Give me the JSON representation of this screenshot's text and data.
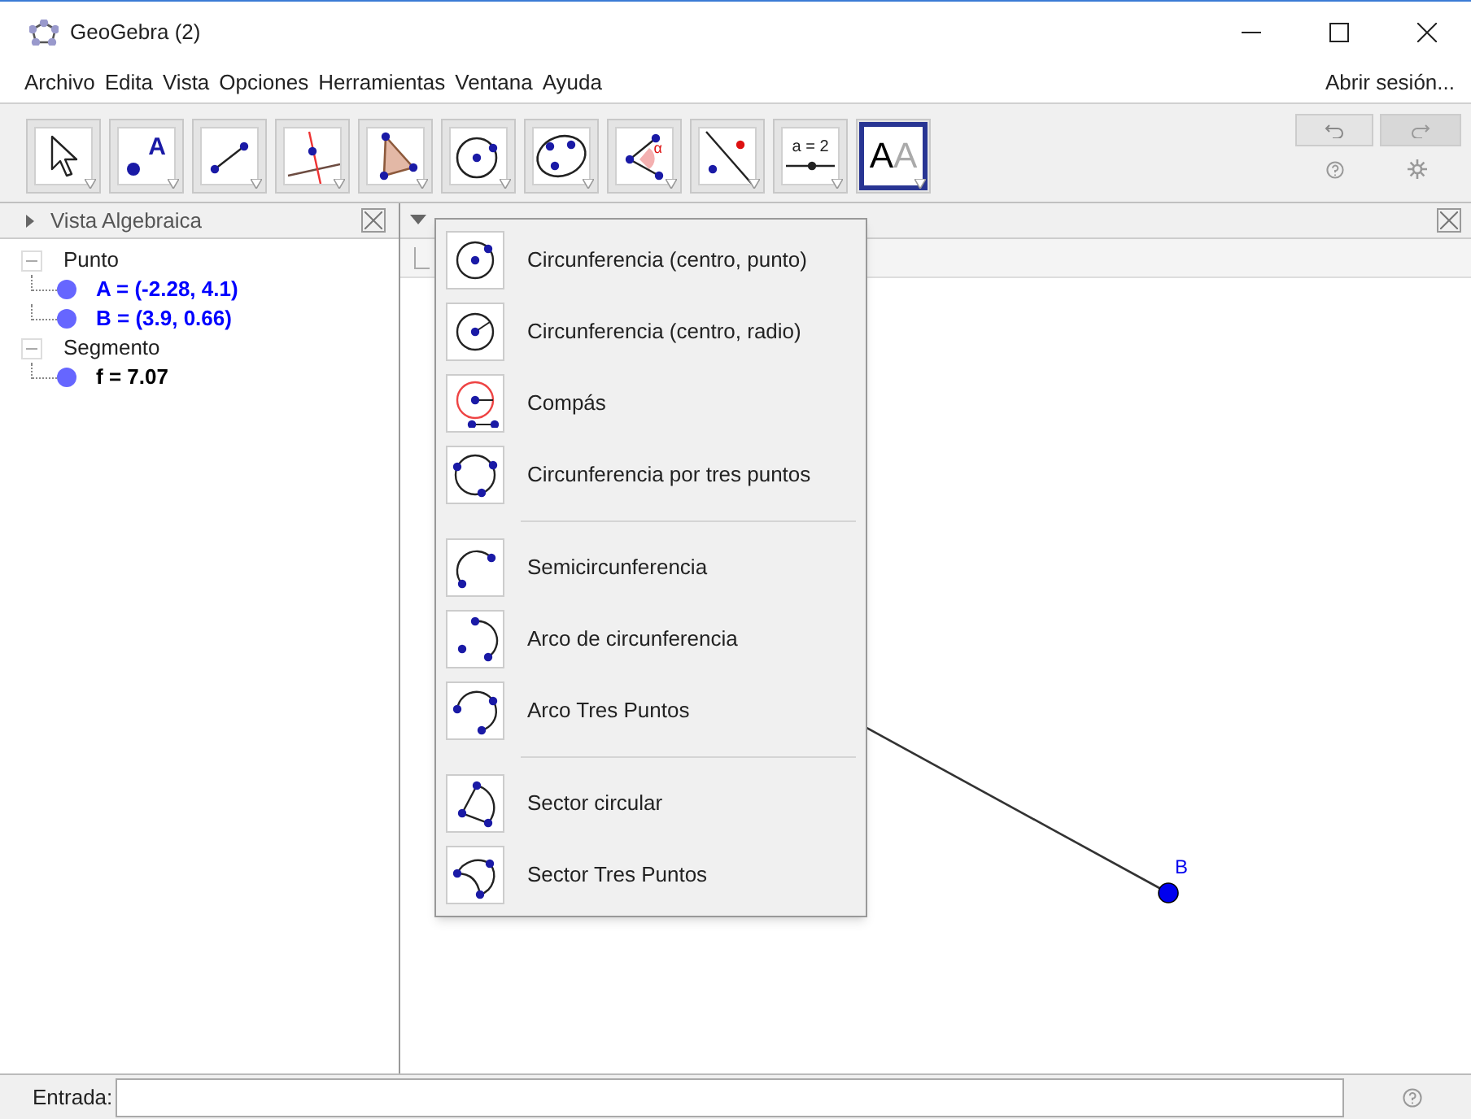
{
  "window": {
    "title": "GeoGebra (2)"
  },
  "menu_bar": {
    "items": [
      "Archivo",
      "Edita",
      "Vista",
      "Opciones",
      "Herramientas",
      "Ventana",
      "Ayuda"
    ],
    "sign_in": "Abrir sesión..."
  },
  "toolbar": {
    "tools": [
      {
        "kind": "move",
        "selected": false
      },
      {
        "kind": "point",
        "label": "A",
        "selected": false
      },
      {
        "kind": "segment",
        "selected": false
      },
      {
        "kind": "perpendicular",
        "selected": false
      },
      {
        "kind": "polygon",
        "selected": false
      },
      {
        "kind": "circle",
        "selected": false
      },
      {
        "kind": "conic",
        "selected": false
      },
      {
        "kind": "angle",
        "label": "α",
        "selected": false
      },
      {
        "kind": "reflect",
        "selected": false
      },
      {
        "kind": "slider",
        "label": "a = 2",
        "selected": false
      },
      {
        "kind": "text_style",
        "label": "AA",
        "selected": true
      }
    ]
  },
  "algebra_view": {
    "title": "Vista Algebraica",
    "tree": [
      {
        "label": "Punto",
        "expanded": true,
        "children": [
          {
            "text": "A = (-2.28, 4.1)",
            "color": "#0000ff"
          },
          {
            "text": "B = (3.9, 0.66)",
            "color": "#0000ff"
          }
        ]
      },
      {
        "label": "Segmento",
        "expanded": true,
        "children": [
          {
            "text": "f = 7.07",
            "color": "#000000"
          }
        ]
      }
    ]
  },
  "graphics_view": {
    "point_label": "B"
  },
  "tool_menu": {
    "groups": [
      [
        {
          "kind": "circle_center_point",
          "label": "Circunferencia (centro, punto)"
        },
        {
          "kind": "circle_center_radius",
          "label": "Circunferencia (centro, radio)"
        },
        {
          "kind": "compass",
          "label": "Compás"
        },
        {
          "kind": "circle_three_points",
          "label": "Circunferencia por tres puntos"
        }
      ],
      [
        {
          "kind": "semicircle",
          "label": "Semicircunferencia"
        },
        {
          "kind": "arc",
          "label": "Arco de circunferencia"
        },
        {
          "kind": "arc_three_points",
          "label": "Arco Tres Puntos"
        }
      ],
      [
        {
          "kind": "sector",
          "label": "Sector circular"
        },
        {
          "kind": "sector_three_points",
          "label": "Sector Tres Puntos"
        }
      ]
    ]
  },
  "input_bar": {
    "label": "Entrada:"
  }
}
